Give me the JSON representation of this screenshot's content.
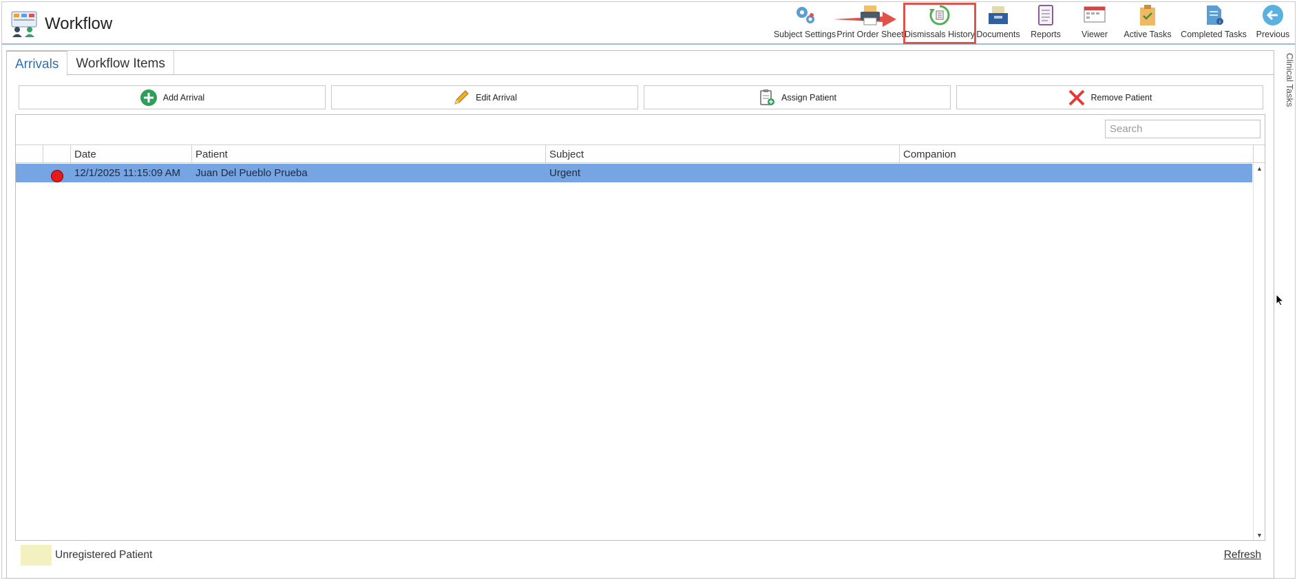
{
  "app": {
    "title": "Workflow"
  },
  "toolbar": {
    "items": [
      {
        "id": "subject-settings",
        "label": "Subject Settings",
        "icon": "gears-icon"
      },
      {
        "id": "print-order-sheet",
        "label": "Print Order Sheet",
        "icon": "printer-icon"
      },
      {
        "id": "dismissals-history",
        "label": "Dismissals History",
        "icon": "history-icon",
        "highlighted": true
      },
      {
        "id": "documents",
        "label": "Documents",
        "icon": "document-tray-icon"
      },
      {
        "id": "reports",
        "label": "Reports",
        "icon": "report-clipboard-icon"
      },
      {
        "id": "viewer",
        "label": "Viewer",
        "icon": "calendar-viewer-icon"
      },
      {
        "id": "active-tasks",
        "label": "Active Tasks",
        "icon": "task-box-icon"
      },
      {
        "id": "completed-tasks",
        "label": "Completed Tasks",
        "icon": "completed-document-icon"
      },
      {
        "id": "previous",
        "label": "Previous",
        "icon": "back-arrow-icon"
      }
    ]
  },
  "side_tab": {
    "label": "Clinical Tasks"
  },
  "tabs": [
    {
      "label": "Arrivals",
      "active": true
    },
    {
      "label": "Workflow Items",
      "active": false
    }
  ],
  "actions": [
    {
      "label": "Add Arrival",
      "icon": "plus-circle-icon"
    },
    {
      "label": "Edit Arrival",
      "icon": "pencil-icon"
    },
    {
      "label": "Assign Patient",
      "icon": "clipboard-add-icon"
    },
    {
      "label": "Remove Patient",
      "icon": "red-x-icon"
    }
  ],
  "search": {
    "placeholder": "Search",
    "value": ""
  },
  "grid": {
    "columns": [
      "",
      "",
      "Date",
      "Patient",
      "Subject",
      "Companion"
    ],
    "rows": [
      {
        "status": "red",
        "date": "12/1/2025 11:15:09 AM",
        "patient": "Juan Del Pueblo Prueba",
        "subject": "Urgent",
        "companion": ""
      }
    ]
  },
  "legend": {
    "label": "Unregistered Patient",
    "color": "#f4f1c0"
  },
  "refresh": {
    "label": "Refresh"
  },
  "colors": {
    "accent": "#2f6fb5",
    "selected_row": "#77a5e3",
    "highlight": "#e0534a"
  }
}
